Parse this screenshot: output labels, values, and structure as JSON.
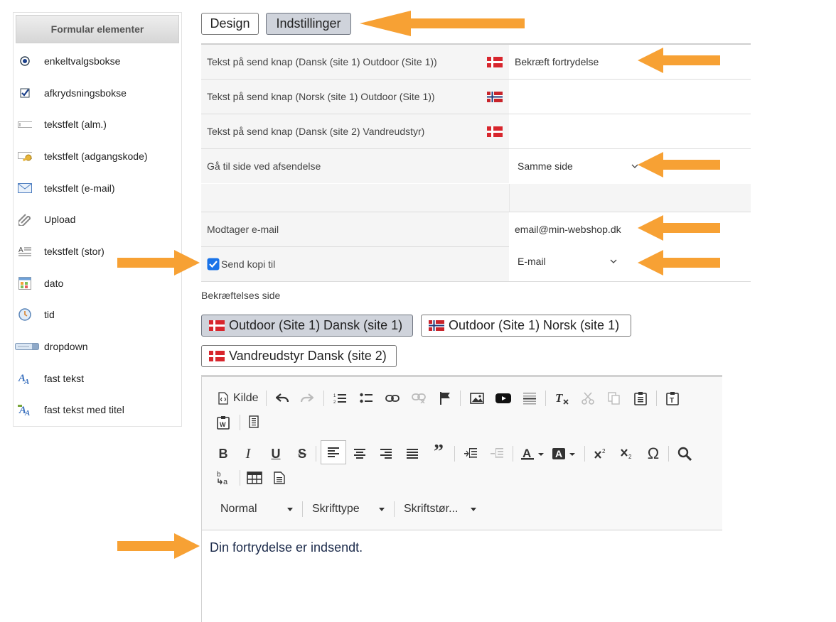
{
  "sidebar": {
    "header": "Formular elementer",
    "items": [
      {
        "label": "enkeltvalgsbokse",
        "icon": "radio-icon"
      },
      {
        "label": "afkrydsningsbokse",
        "icon": "checkbox-icon"
      },
      {
        "label": "tekstfelt (alm.)",
        "icon": "textfield-icon"
      },
      {
        "label": "tekstfelt (adgangskode)",
        "icon": "key-icon"
      },
      {
        "label": "tekstfelt (e-mail)",
        "icon": "envelope-icon"
      },
      {
        "label": "Upload",
        "icon": "paperclip-icon"
      },
      {
        "label": "tekstfelt (stor)",
        "icon": "textarea-icon"
      },
      {
        "label": "dato",
        "icon": "calendar-icon"
      },
      {
        "label": "tid",
        "icon": "clock-icon"
      },
      {
        "label": "dropdown",
        "icon": "dropdown-icon"
      },
      {
        "label": "fast tekst",
        "icon": "text-icon"
      },
      {
        "label": "fast tekst med titel",
        "icon": "text-title-icon"
      }
    ]
  },
  "tabs": [
    {
      "label": "Design",
      "active": false
    },
    {
      "label": "Indstillinger",
      "active": true
    }
  ],
  "form": {
    "rows": [
      {
        "label": "Tekst på send knap (Dansk (site 1) Outdoor (Site 1))",
        "flag": "dk",
        "value": "Bekræft fortrydelse"
      },
      {
        "label": "Tekst på send knap (Norsk (site 1) Outdoor (Site 1))",
        "flag": "no",
        "value": ""
      },
      {
        "label": "Tekst på send knap (Dansk (site 2) Vandreudstyr)",
        "flag": "dk",
        "value": ""
      }
    ],
    "redirect": {
      "label": "Gå til side ved afsendelse",
      "value": "Samme side"
    },
    "recipient": {
      "label": "Modtager e-mail",
      "value": "email@min-webshop.dk"
    },
    "copy": {
      "label": "Send kopi til",
      "checked": true,
      "value": "E-mail"
    }
  },
  "confirmation": {
    "label": "Bekræftelses side",
    "languages": [
      {
        "label": "Outdoor (Site 1) Dansk (site 1)",
        "flag": "dk",
        "active": true
      },
      {
        "label": "Outdoor (Site 1) Norsk (site 1)",
        "flag": "no",
        "active": false
      },
      {
        "label": "Vandreudstyr Dansk (site 2)",
        "flag": "dk",
        "active": false
      }
    ]
  },
  "editor": {
    "source_label": "Kilde",
    "format_combo": "Normal",
    "font_combo": "Skrifttype",
    "size_combo": "Skriftstør...",
    "content": "Din fortrydelse er indsendt."
  },
  "colors": {
    "arrow": "#f7a134",
    "active_button": "#cfd3db",
    "checkbox": "#1a73e8"
  }
}
